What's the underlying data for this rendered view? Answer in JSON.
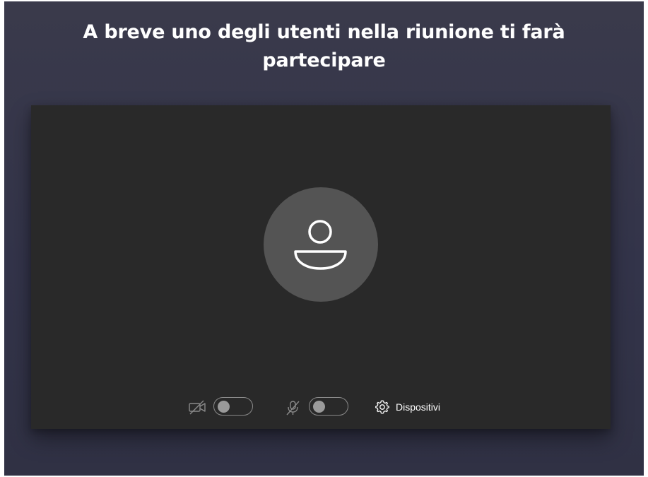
{
  "screen": {
    "title": "A breve uno degli utenti nella riunione ti farà partecipare"
  },
  "preview": {
    "avatar_icon": "person-icon",
    "camera": {
      "icon": "camera-off-icon",
      "enabled": false
    },
    "microphone": {
      "icon": "mic-off-icon",
      "enabled": false
    },
    "devices": {
      "icon": "gear-icon",
      "label": "Dispositivi"
    }
  },
  "colors": {
    "background": "#3a3a4b",
    "preview_background": "#292929",
    "avatar_circle": "#545454",
    "text": "#ffffff",
    "toggle_off": "#8a8a8a"
  }
}
